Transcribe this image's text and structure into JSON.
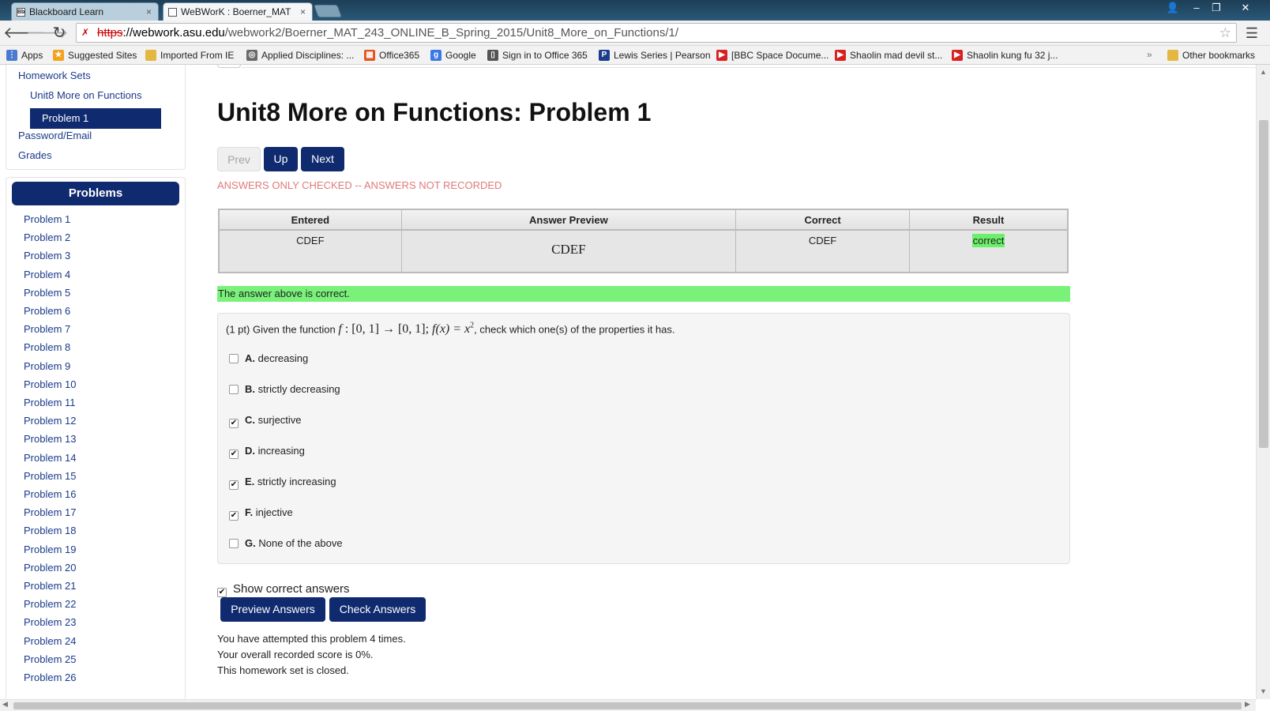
{
  "browser": {
    "tabs": [
      {
        "label": "Blackboard Learn",
        "favicon": "Bb"
      },
      {
        "label": "WeBWorK : Boerner_MAT"
      }
    ],
    "url": {
      "scheme": "https",
      "host": "://webwork.asu.edu",
      "path": "/webwork2/Boerner_MAT_243_ONLINE_B_Spring_2015/Unit8_More_on_Functions/1/"
    },
    "bookmarks": [
      {
        "label": "Apps",
        "icon": "apps-grid-icon",
        "color": "#4a7bd0"
      },
      {
        "label": "Suggested Sites",
        "icon": "suggested-sites-icon",
        "color": "#f4a21d"
      },
      {
        "label": "Imported From IE",
        "icon": "folder-icon",
        "color": "#e3b740"
      },
      {
        "label": "Applied Disciplines: ...",
        "icon": "disciplines-icon",
        "color": "#6a6a6a"
      },
      {
        "label": "Office365",
        "icon": "office365-icon",
        "color": "#e8541c"
      },
      {
        "label": "Google",
        "icon": "google-icon",
        "color": "#3b78e7"
      },
      {
        "label": "Sign in to Office 365",
        "icon": "office-signin-icon",
        "color": "#555555"
      },
      {
        "label": "Lewis Series | Pearson",
        "icon": "pearson-icon",
        "color": "#1c3d8c"
      },
      {
        "label": "[BBC Space Docume...",
        "icon": "youtube-icon",
        "color": "#d82020"
      },
      {
        "label": "Shaolin mad devil st...",
        "icon": "youtube-icon",
        "color": "#d82020"
      },
      {
        "label": "Shaolin kung fu 32 j...",
        "icon": "youtube-icon",
        "color": "#d82020"
      },
      {
        "label": "Other bookmarks",
        "icon": "folder-icon",
        "color": "#e3b740"
      }
    ],
    "overflow": "»"
  },
  "sidebar": {
    "links": {
      "homework_sets": "Homework Sets",
      "set": "Unit8 More on Functions",
      "current": "Problem 1",
      "password": "Password/Email",
      "grades": "Grades"
    },
    "problems_heading": "Problems",
    "problems": [
      "Problem 1",
      "Problem 2",
      "Problem 3",
      "Problem 4",
      "Problem 5",
      "Problem 6",
      "Problem 7",
      "Problem 8",
      "Problem 9",
      "Problem 10",
      "Problem 11",
      "Problem 12",
      "Problem 13",
      "Problem 14",
      "Problem 15",
      "Problem 16",
      "Problem 17",
      "Problem 18",
      "Problem 19",
      "Problem 20",
      "Problem 21",
      "Problem 22",
      "Problem 23",
      "Problem 24",
      "Problem 25",
      "Problem 26"
    ]
  },
  "main": {
    "title": "Unit8 More on Functions: Problem 1",
    "nav": {
      "prev": "Prev",
      "up": "Up",
      "next": "Next"
    },
    "notice": "ANSWERS ONLY CHECKED -- ANSWERS NOT RECORDED",
    "results": {
      "headers": [
        "Entered",
        "Answer Preview",
        "Correct",
        "Result"
      ],
      "entered": "CDEF",
      "preview": "CDEF",
      "correct": "CDEF",
      "result": "correct"
    },
    "answer_message": "The answer above is correct.",
    "question": {
      "points": "(1 pt) Given the function",
      "math": {
        "f": "f",
        "colon": " : ",
        "domain": "[0, 1]",
        "arrow": " → ",
        "codomain": "[0, 1]",
        "sep": "; ",
        "fx": "f(x) = x",
        "exp": "2"
      },
      "tail": ", check which one(s) of the properties it has."
    },
    "options": [
      {
        "letter": "A.",
        "text": "decreasing",
        "checked": false
      },
      {
        "letter": "B.",
        "text": "strictly decreasing",
        "checked": false
      },
      {
        "letter": "C.",
        "text": "surjective",
        "checked": true
      },
      {
        "letter": "D.",
        "text": "increasing",
        "checked": true
      },
      {
        "letter": "E.",
        "text": "strictly increasing",
        "checked": true
      },
      {
        "letter": "F.",
        "text": "injective",
        "checked": true
      },
      {
        "letter": "G.",
        "text": "None of the above",
        "checked": false
      }
    ],
    "show_correct": {
      "label": "Show correct answers",
      "checked": true
    },
    "buttons": {
      "preview": "Preview Answers",
      "check": "Check Answers"
    },
    "status": [
      "You have attempted this problem 4 times.",
      "Your overall recorded score is 0%.",
      "This homework set is closed."
    ]
  },
  "colors": {
    "primary": "#0f2a6e",
    "success": "#7af27a",
    "notice": "#e07a7a"
  }
}
